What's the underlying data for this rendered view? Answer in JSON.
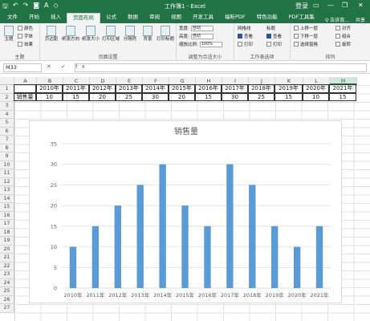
{
  "titlebar": {
    "title": "工作簿1 - Excel",
    "qat": [
      "save-icon",
      "undo-icon",
      "redo-icon",
      "camera-icon",
      "font-color-icon",
      "clear-icon"
    ],
    "controls": [
      "登录",
      "▭",
      "—",
      "❐",
      "✕"
    ]
  },
  "ribbon_tabs": [
    "文件",
    "开始",
    "插入",
    "页面布局",
    "公式",
    "数据",
    "审阅",
    "视图",
    "开发工具",
    "福昕PDF",
    "特色功能",
    "PDF工具集"
  ],
  "active_tab": "页面布局",
  "tell_me": "♀ 告诉我...",
  "share": "共享",
  "ribbon": {
    "themes": {
      "label": "主题",
      "buttons": [
        "主题"
      ],
      "small": [
        "颜色",
        "字体",
        "效果"
      ]
    },
    "page_setup": {
      "label": "页面设置",
      "buttons": [
        "页边距",
        "纸张方向",
        "纸张大小",
        "打印区域",
        "分隔符",
        "背景",
        "打印标题"
      ]
    },
    "scale_to_fit": {
      "label": "调整为合适大小",
      "rows": [
        {
          "name": "宽度:",
          "value": "自动"
        },
        {
          "name": "高度:",
          "value": "自动"
        },
        {
          "name": "缩放比例:",
          "value": "100%"
        }
      ]
    },
    "sheet_options": {
      "label": "工作表选项",
      "gridlines": "网格线",
      "headings": "标题",
      "view": "查看",
      "print": "打印"
    },
    "arrange": {
      "label": "排列",
      "items": [
        "上移一层",
        "下移一层",
        "选择窗格",
        "对齐",
        "组合",
        "旋转"
      ]
    }
  },
  "formula_bar": {
    "name_box": "M33",
    "icons": "✕ ✓ fx",
    "value": ""
  },
  "columns": [
    "A",
    "B",
    "C",
    "D",
    "E",
    "F",
    "G",
    "H",
    "I",
    "J",
    "K",
    "L",
    "M"
  ],
  "selected_column": "M",
  "rows": [
    "1",
    "2",
    "3",
    "4",
    "5",
    "6",
    "7",
    "8",
    "9",
    "10",
    "11",
    "12",
    "13",
    "14",
    "15",
    "16",
    "17",
    "18",
    "19",
    "20",
    "21",
    "22",
    "23",
    "24",
    "25",
    "26",
    "27"
  ],
  "table": {
    "row1": [
      "",
      "2010年",
      "2011年",
      "2012年",
      "2013年",
      "2014年",
      "2015年",
      "2016年",
      "2017年",
      "2018年",
      "2019年",
      "2020年",
      "2021年"
    ],
    "row2": [
      "销售量",
      "10",
      "15",
      "20",
      "25",
      "30",
      "20",
      "15",
      "30",
      "25",
      "15",
      "10",
      "15"
    ]
  },
  "chart_data": {
    "type": "bar",
    "title": "销售量",
    "categories": [
      "2010年",
      "2011年",
      "2012年",
      "2013年",
      "2014年",
      "2015年",
      "2016年",
      "2017年",
      "2018年",
      "2019年",
      "2020年",
      "2021年"
    ],
    "values": [
      10,
      15,
      20,
      25,
      30,
      20,
      15,
      30,
      25,
      15,
      10,
      15
    ],
    "ylim": [
      0,
      35
    ],
    "yticks": [
      0,
      5,
      10,
      15,
      20,
      25,
      30,
      35
    ],
    "grid": true,
    "color": "#5b9bd5"
  }
}
